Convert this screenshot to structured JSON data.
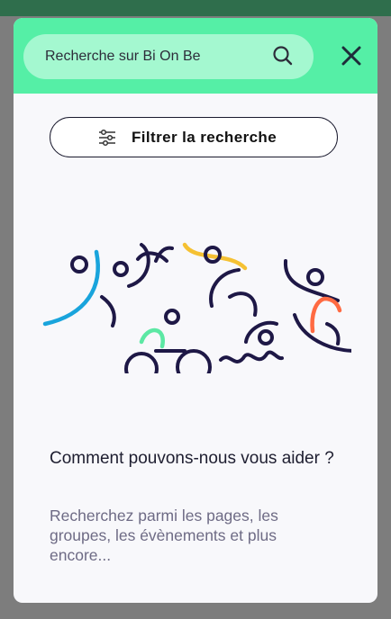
{
  "search": {
    "placeholder": "Recherche sur Bi On Be",
    "value": ""
  },
  "filter_button": {
    "label": "Filtrer la recherche"
  },
  "help": {
    "title": "Comment pouvons-nous vous aider ?",
    "description": "Recherchez parmi les pages, les groupes, les évènements et plus encore..."
  },
  "icons": {
    "search": "search-icon",
    "close": "close-icon",
    "filter": "filter-sliders-icon"
  },
  "colors": {
    "header_bg": "#55efa6",
    "search_bg": "#a4f8d0",
    "modal_bg": "#f8f8fb",
    "overlay": "#7d7d7d",
    "illustration_dark": "#1e1846",
    "illustration_blue": "#19a4dc",
    "illustration_yellow": "#f5c133",
    "illustration_green": "#5ce8a4",
    "illustration_orange": "#ff6a42"
  }
}
